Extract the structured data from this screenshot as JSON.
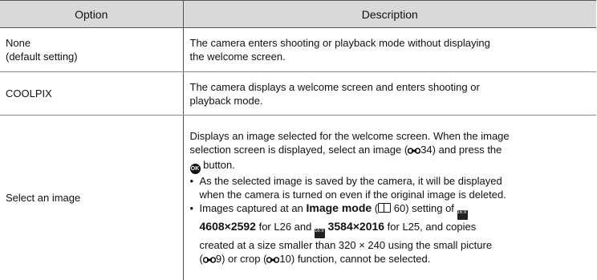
{
  "header": {
    "option": "Option",
    "description": "Description"
  },
  "rows": [
    {
      "option_lines": [
        "None",
        "(default setting)"
      ],
      "desc_lines": [
        "The camera enters shooting or playback mode without displaying",
        "the welcome screen."
      ]
    },
    {
      "option_lines": [
        "COOLPIX"
      ],
      "desc_lines": [
        "The camera displays a welcome screen and enters shooting or",
        "playback mode."
      ]
    },
    {
      "option_lines": [
        "Select an image"
      ],
      "intro": {
        "l1": "Displays an image selected for the welcome screen. When the image",
        "l2": "selection screen is displayed, select an image (",
        "l2_ref": "34",
        "l2_end": ") and press the",
        "l3_end": " button."
      },
      "bullet1": [
        "As the selected image is saved by the camera, it will be displayed",
        "when the camera is turned on even if the original image is deleted."
      ],
      "bullet2": {
        "l1_a": "Images captured at an ",
        "l1_bold": "Image mode",
        "l1_b": " (",
        "l1_ref": " 60) setting of ",
        "l2_bold": "4608×2592",
        "l2_a": " for L26 and ",
        "l2_bold2": "3584×2016",
        "l2_b": " for L25, and copies",
        "l3": "created at a size smaller than 320 × 240 using the small picture",
        "l4_a": "(",
        "l4_ref1": "9) or crop (",
        "l4_ref2": "10) function, cannot be selected."
      }
    }
  ],
  "icons": {
    "ok_button": "OK",
    "image_mode_a": "16:9 12M",
    "image_mode_b": "16:9 7M"
  }
}
